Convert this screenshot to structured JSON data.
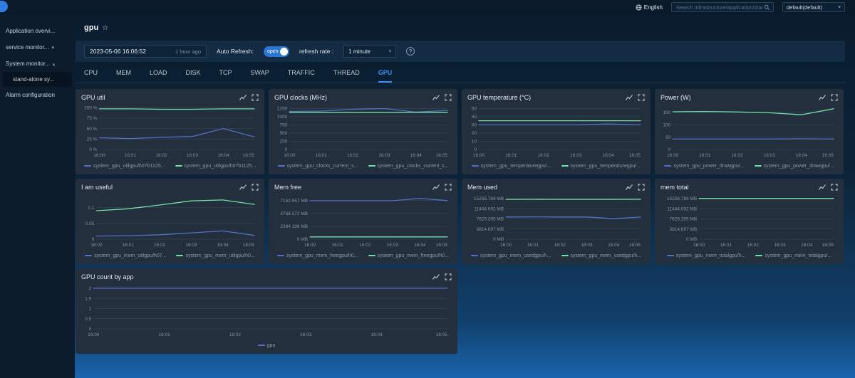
{
  "topbar": {
    "language": "English",
    "search_placeholder": "Search infrastructure/application/stan...",
    "profile_value": "default(default)"
  },
  "sidebar": {
    "items": [
      {
        "label": "Application overvi..."
      },
      {
        "label": "service monitor...",
        "chevron": "down"
      },
      {
        "label": "System monitor...",
        "chevron": "up"
      },
      {
        "label": "stand-alone sy...",
        "selected": true,
        "indent": true
      },
      {
        "label": "Alarm configuration"
      }
    ]
  },
  "page": {
    "title": "gpu",
    "star_icon": "☆"
  },
  "toolbar": {
    "datetime": "2023-05-06 16:06:52",
    "relative_time": "1 hour ago",
    "auto_refresh_label": "Auto Refresh:",
    "toggle_label": "open",
    "refresh_rate_label": "refresh rate :",
    "refresh_rate_value": "1 minute",
    "help_icon": "?"
  },
  "tabs": {
    "active": "GPU",
    "items": [
      "CPU",
      "MEM",
      "LOAD",
      "DISK",
      "TCP",
      "SWAP",
      "TRAFFIC",
      "THREAD",
      "GPU"
    ]
  },
  "colors": {
    "accent_blue": "#3e8ef7",
    "toggle_blue": "#2a76d2",
    "series_blue": "#5470c6",
    "series_green": "#74dfa2"
  },
  "charts": [
    {
      "title": "GPU util",
      "type": "line",
      "x": [
        "16:00",
        "16:01",
        "16:02",
        "16:03",
        "16:04",
        "16:05"
      ],
      "ylim": [
        0,
        102
      ],
      "yticks": [
        {
          "v": 0,
          "label": "0 %"
        },
        {
          "v": 25,
          "label": "25 %"
        },
        {
          "v": 50,
          "label": "50 %"
        },
        {
          "v": 75,
          "label": "75 %"
        },
        {
          "v": 100,
          "label": "100 %"
        }
      ],
      "series": [
        {
          "name": "system_gpu_utilgpu/h07b1125...",
          "color": "#5470c6",
          "values": [
            28,
            26,
            29,
            31,
            50,
            30
          ]
        },
        {
          "name": "system_gpu_utilgpu/h07b1125...",
          "color": "#74dfa2",
          "values": [
            97,
            97,
            96,
            96,
            97,
            97
          ]
        }
      ]
    },
    {
      "title": "GPU clocks (MHz)",
      "type": "line",
      "x": [
        "16:00",
        "16:01",
        "16:02",
        "16:03",
        "16:04",
        "16:05"
      ],
      "ylim": [
        0,
        1300
      ],
      "yticks": [
        {
          "v": 0,
          "label": "0"
        },
        {
          "v": 250,
          "label": "250"
        },
        {
          "v": 500,
          "label": "500"
        },
        {
          "v": 750,
          "label": "750"
        },
        {
          "v": 1000,
          "label": "1000"
        },
        {
          "v": 1250,
          "label": "1250"
        }
      ],
      "series": [
        {
          "name": "system_gpu_clocks_current_s...",
          "color": "#5470c6",
          "values": [
            1160,
            1170,
            1225,
            1245,
            1140,
            1190
          ]
        },
        {
          "name": "system_gpu_clocks_current_s...",
          "color": "#74dfa2",
          "values": [
            1130,
            1130,
            1130,
            1130,
            1130,
            1130
          ]
        }
      ]
    },
    {
      "title": "GPU temperature (°C)",
      "type": "line",
      "x": [
        "16:00",
        "16:01",
        "16:02",
        "16:03",
        "16:04",
        "16:05"
      ],
      "ylim": [
        0,
        52
      ],
      "yticks": [
        {
          "v": 0,
          "label": "0"
        },
        {
          "v": 10,
          "label": "10"
        },
        {
          "v": 20,
          "label": "20"
        },
        {
          "v": 30,
          "label": "30"
        },
        {
          "v": 40,
          "label": "40"
        },
        {
          "v": 50,
          "label": "50"
        }
      ],
      "series": [
        {
          "name": "system_gpu_temperaturegpu/...",
          "color": "#5470c6",
          "values": [
            30,
            30,
            30,
            30,
            31,
            30
          ]
        },
        {
          "name": "system_gpu_temperaturegpu/...",
          "color": "#74dfa2",
          "values": [
            35,
            35,
            35,
            35,
            35,
            35
          ]
        }
      ]
    },
    {
      "title": "Power (W)",
      "type": "line",
      "x": [
        "16:00",
        "16:01",
        "16:02",
        "16:03",
        "16:04",
        "16:05"
      ],
      "ylim": [
        0,
        172
      ],
      "yticks": [
        {
          "v": 0,
          "label": "0"
        },
        {
          "v": 50,
          "label": "50"
        },
        {
          "v": 100,
          "label": "100"
        },
        {
          "v": 150,
          "label": "150"
        }
      ],
      "series": [
        {
          "name": "system_gpu_power_drawgpu/...",
          "color": "#5470c6",
          "values": [
            42,
            42,
            42,
            42,
            43,
            42
          ]
        },
        {
          "name": "system_gpu_power_drawgpu/...",
          "color": "#74dfa2",
          "values": [
            152,
            153,
            151,
            148,
            140,
            164
          ]
        }
      ]
    },
    {
      "title": "I am useful",
      "type": "line",
      "x": [
        "16:00",
        "16:01",
        "16:02",
        "16:03",
        "16:04",
        "16:05"
      ],
      "ylim": [
        0,
        0.135
      ],
      "yticks": [
        {
          "v": 0,
          "label": "0"
        },
        {
          "v": 0.05,
          "label": "0.05"
        },
        {
          "v": 0.1,
          "label": "0.1"
        }
      ],
      "series": [
        {
          "name": "system_gpu_mem_utilgpu/h07...",
          "color": "#5470c6",
          "values": [
            0.01,
            0.011,
            0.014,
            0.02,
            0.026,
            0.012
          ]
        },
        {
          "name": "system_gpu_mem_utilgpu/h0...",
          "color": "#74dfa2",
          "values": [
            0.09,
            0.096,
            0.108,
            0.121,
            0.124,
            0.11
          ]
        }
      ]
    },
    {
      "title": "Mem free",
      "type": "line",
      "x": [
        "16:00",
        "16:01",
        "16:02",
        "16:03",
        "16:04",
        "16:05"
      ],
      "ylim": [
        0,
        7900
      ],
      "yticks": [
        {
          "v": 0,
          "label": "0 MB"
        },
        {
          "v": 2384.198,
          "label": "2384.198 MB"
        },
        {
          "v": 4768.372,
          "label": "4768.372 MB"
        },
        {
          "v": 7152.557,
          "label": "7152.557 MB"
        }
      ],
      "series": [
        {
          "name": "system_gpu_mem_freegpu/h0...",
          "color": "#5470c6",
          "values": [
            7110,
            7105,
            7108,
            7112,
            7560,
            7140
          ]
        },
        {
          "name": "system_gpu_mem_freegpu/h0...",
          "color": "#74dfa2",
          "values": [
            420,
            420,
            420,
            420,
            420,
            420
          ]
        }
      ]
    },
    {
      "title": "Mem used",
      "type": "line",
      "x": [
        "16:00",
        "16:01",
        "16:02",
        "16:03",
        "16:04",
        "16:05"
      ],
      "ylim": [
        0,
        16000
      ],
      "yticks": [
        {
          "v": 0,
          "label": "0 MB"
        },
        {
          "v": 3814.697,
          "label": "3814.697 MB"
        },
        {
          "v": 7629.395,
          "label": "7629.395 MB"
        },
        {
          "v": 11444.092,
          "label": "11444.092 MB"
        },
        {
          "v": 15258.789,
          "label": "15258.789 MB"
        }
      ],
      "series": [
        {
          "name": "system_gpu_mem_usedgpu/h...",
          "color": "#5470c6",
          "values": [
            8330,
            8335,
            8330,
            8320,
            7690,
            8300
          ]
        },
        {
          "name": "system_gpu_mem_usedgpu/h...",
          "color": "#74dfa2",
          "values": [
            14920,
            14925,
            14920,
            14915,
            14920,
            14930
          ]
        }
      ]
    },
    {
      "title": "mem total",
      "type": "line",
      "x": [
        "16:00",
        "16:01",
        "16:02",
        "16:03",
        "16:04",
        "16:05"
      ],
      "ylim": [
        0,
        16000
      ],
      "yticks": [
        {
          "v": 0,
          "label": "0 MB"
        },
        {
          "v": 3814.697,
          "label": "3814.697 MB"
        },
        {
          "v": 7629.395,
          "label": "7629.395 MB"
        },
        {
          "v": 11444.092,
          "label": "11444.092 MB"
        },
        {
          "v": 15258.789,
          "label": "15258.789 MB"
        }
      ],
      "series": [
        {
          "name": "system_gpu_mem_totalgpu/h...",
          "color": "#5470c6",
          "values": [
            15258.789,
            15258.789,
            15258.789,
            15258.789,
            15258.789,
            15258.789
          ]
        },
        {
          "name": "system_gpu_mem_totalgpu/...",
          "color": "#74dfa2",
          "values": [
            15258.789,
            15258.789,
            15258.789,
            15258.789,
            15258.789,
            15258.789
          ]
        }
      ]
    },
    {
      "title": "GPU count by app",
      "type": "line",
      "wide": true,
      "x": [
        "16:00",
        "16:01",
        "16:02",
        "16:03",
        "16:04",
        "16:05"
      ],
      "ylim": [
        0,
        2.1
      ],
      "yticks": [
        {
          "v": 0,
          "label": "0"
        },
        {
          "v": 0.5,
          "label": "0.5"
        },
        {
          "v": 1,
          "label": "1"
        },
        {
          "v": 1.5,
          "label": "1.5"
        },
        {
          "v": 2,
          "label": "2"
        }
      ],
      "series": [
        {
          "name": "gpu",
          "color": "#5470c6",
          "values": [
            2,
            2,
            2,
            2,
            2,
            2
          ]
        }
      ]
    }
  ]
}
